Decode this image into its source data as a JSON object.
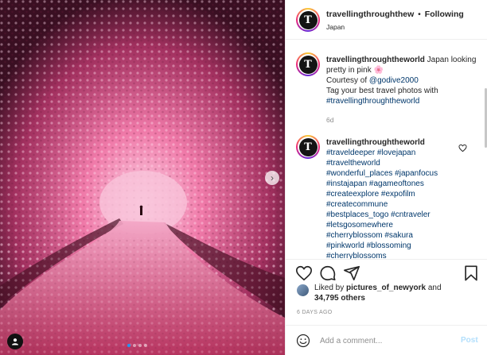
{
  "post": {
    "author": "travellingthroughtheworld",
    "author_header": "travellingthroughthew",
    "follow_separator": "•",
    "follow_status": "Following",
    "location": "Japan",
    "avatar_letter": "T"
  },
  "caption": {
    "username": "travellingthroughtheworld",
    "line1": "Japan looking pretty in pink",
    "emoji": "🌸",
    "line2_prefix": "Courtesy of",
    "mention": "@godive2000",
    "line3": "Tag your best travel photos with",
    "hashtag": "#travellingthroughtheworld",
    "age": "6d"
  },
  "comment": {
    "username": "travellingthroughtheworld",
    "hashtags": [
      "#traveldeeper #lovejapan",
      "#traveltheworld",
      "#wonderful_places #japanfocus",
      "#instajapan #agameoftones",
      "#createexplore #expofilm",
      "#createcommune",
      "#bestplaces_togo #cntraveler",
      "#letsgosomewhere",
      "#cherryblossom #sakura",
      "#pinkworld #blossoming",
      "#cherryblossoms"
    ]
  },
  "likes": {
    "prefix": "Liked by",
    "user": "pictures_of_newyork",
    "and": "and",
    "count": "34,795 others"
  },
  "post_date": "6 DAYS AGO",
  "composer": {
    "placeholder": "Add a comment...",
    "post_label": "Post"
  },
  "carousel": {
    "slide_count": 4,
    "active_index": 0
  },
  "colors": {
    "link": "#00376b",
    "muted": "#8e8e8e",
    "post_disabled": "#b2dffc",
    "active_dot": "#2196f3"
  },
  "icons": [
    "heart-icon",
    "comment-icon",
    "share-icon",
    "bookmark-icon",
    "emoji-icon",
    "user-tag-icon",
    "chevron-right-icon"
  ]
}
